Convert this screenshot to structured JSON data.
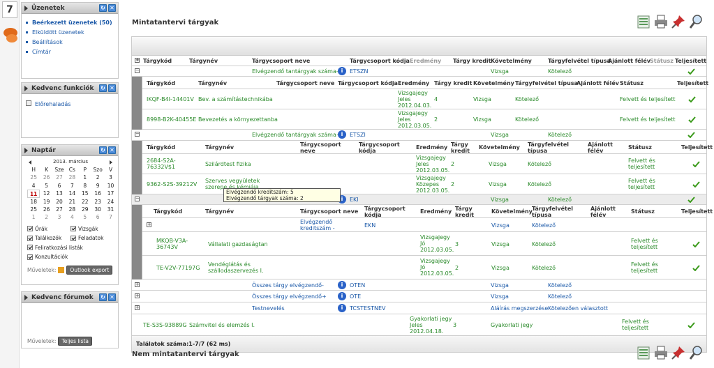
{
  "iconbar": {
    "calendar_day": "7"
  },
  "messages": {
    "title": "Üzenetek",
    "links": [
      "Beérkezett üzenetek (50)",
      "Elküldött üzenetek",
      "Beállítások",
      "Címtár"
    ]
  },
  "favorites": {
    "title": "Kedvenc funkciók",
    "links": [
      "Előrehaladás"
    ]
  },
  "calendar": {
    "title": "Naptár",
    "month": "2013. március",
    "weekdays": [
      "H",
      "K",
      "Sze",
      "Cs",
      "P",
      "Szo",
      "V"
    ],
    "days": [
      "25",
      "26",
      "27",
      "28",
      "1",
      "2",
      "3",
      "4",
      "5",
      "6",
      "7",
      "8",
      "9",
      "10",
      "11",
      "12",
      "13",
      "14",
      "15",
      "16",
      "17",
      "18",
      "19",
      "20",
      "21",
      "22",
      "23",
      "24",
      "25",
      "26",
      "27",
      "28",
      "29",
      "30",
      "31",
      "1",
      "2",
      "3",
      "4",
      "5",
      "6",
      "7"
    ],
    "filters": [
      "Órák",
      "Vizsgák",
      "Találkozók",
      "Feladatok",
      "Feliratkozási listák",
      "Konzultációk"
    ],
    "ops_label": "Műveletek:",
    "export_button": "Outlook export"
  },
  "forums": {
    "title": "Kedvenc fórumok",
    "ops_label": "Műveletek:",
    "full_list_button": "Teljes lista"
  },
  "main": {
    "section_title": "Mintatantervi tárgyak",
    "section2_title": "Nem mintatantervi tárgyak",
    "results": "Találatok száma:1-7/7 (62 ms)"
  },
  "table": {
    "header": [
      "Tárgykód",
      "Tárgynév",
      "Tárgycsoport neve",
      "Tárgycsoport kódja",
      "Eredmény",
      "Tárgy kredit",
      "Követelmény",
      "Tárgyfelvétel típusa",
      "Ajánlott félév",
      "Státusz",
      "Teljesített"
    ],
    "groups": [
      {
        "name": "Elvégzendő tantárgyak száma-",
        "code": "ETSZN",
        "req": "Vizsga",
        "type": "Kötelező",
        "rows": [
          {
            "code": "IKQF-B4I-14401V",
            "name": "Bev. a számítástechnikába",
            "result": "Vizsgajegy Jeles 2012.04.03.",
            "credit": "4",
            "req": "Vizsga",
            "type": "Kötelező",
            "status": "Felvett és teljesített"
          },
          {
            "code": "8998-B2K-40455E",
            "name": "Bevezetés a környezettanba",
            "result": "Vizsgajegy Jeles 2012.03.05.",
            "credit": "2",
            "req": "Vizsga",
            "type": "Kötelező",
            "status": "Felvett és teljesített"
          }
        ]
      },
      {
        "name": "Elvégzendő tantárgyak száma+",
        "code": "ETSZI",
        "req": "Vizsga",
        "type": "Kötelező",
        "rows": [
          {
            "code": "2684-S2A-76332V$1",
            "name": "Szilárdtest fizika",
            "result": "Vizsgajegy Jeles 2012.03.05.",
            "credit": "2",
            "req": "Vizsga",
            "type": "Kötelező",
            "status": "Felvett és teljesített"
          },
          {
            "code": "9362-S2S-39212V",
            "name": "Szerves vegyületek szerepe és kémiája",
            "result": "Vizsgajegy Közepes 2012.03.05.",
            "credit": "2",
            "req": "Vizsga",
            "type": "Kötelező",
            "status": "Felvett és teljesített"
          }
        ]
      },
      {
        "name": "",
        "code": "EKI",
        "req": "Vizsga",
        "type": "Kötelező",
        "sub": {
          "name": "Elvégzendő kreditszám -",
          "code": "EKN",
          "req": "Vizsga",
          "type": "Kötelező"
        },
        "rows": [
          {
            "code": "MKQB-V3A-36743V",
            "name": "Vállalati gazdaságtan",
            "result": "Vizsgajegy Jó 2012.03.05.",
            "credit": "3",
            "req": "Vizsga",
            "type": "Kötelező",
            "status": "Felvett és teljesített"
          },
          {
            "code": "TE-V2V-77197G",
            "name": "Vendéglátás és szállodaszervezés I.",
            "result": "Vizsgajegy Jó 2012.03.05.",
            "credit": "2",
            "req": "Vizsga",
            "type": "Kötelező",
            "status": "Felvett és teljesített"
          }
        ]
      }
    ],
    "collapsed": [
      {
        "name": "Összes tárgy elvégzendő-",
        "code": "OTEN",
        "req": "Vizsga",
        "type": "Kötelező"
      },
      {
        "name": "Összes tárgy elvégzendő+",
        "code": "OTE",
        "req": "Vizsga",
        "type": "Kötelező"
      },
      {
        "name": "Testnevelés",
        "code": "TCSTESTNEV",
        "req": "Aláírás megszerzése",
        "type": "Kötelezően választott"
      }
    ],
    "last": {
      "code": "TE-S3S-93889G",
      "name": "Számvitel és elemzés I.",
      "result": "Gyakorlati jegy Jeles 2012.04.18.",
      "credit": "3",
      "req": "Gyakorlati jegy",
      "status": "Felvett és teljesített"
    }
  },
  "tooltip": {
    "line1": "Elvégzendő kreditszám: 5",
    "line2": "Elvégzendő tárgyak száma: 2"
  },
  "colors": {
    "link": "#1a58a8",
    "green": "#2a8a2a",
    "check": "#3a9a1a"
  }
}
